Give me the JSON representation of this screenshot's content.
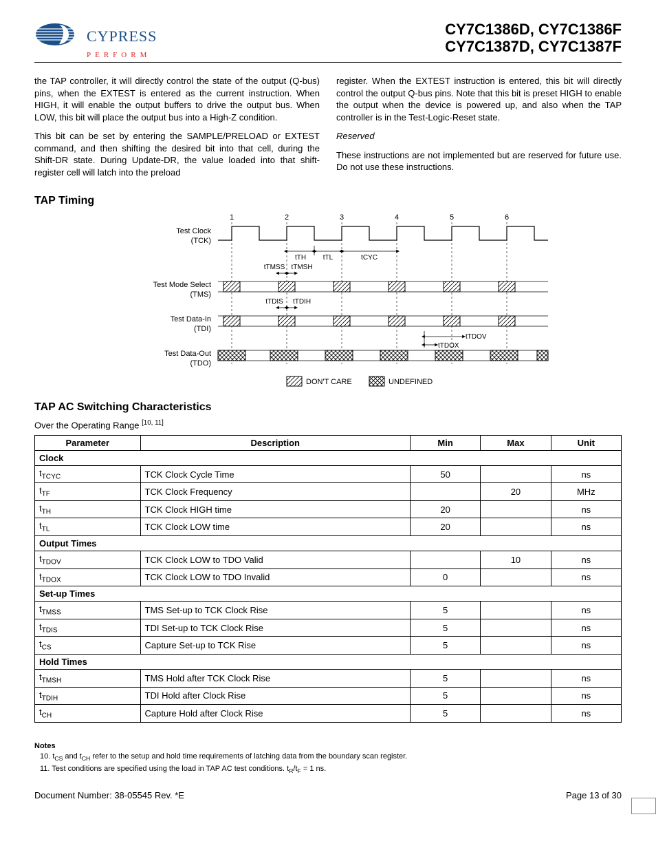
{
  "header": {
    "brand": "CYPRESS",
    "tagline": "PERFORM",
    "part_line1": "CY7C1386D, CY7C1386F",
    "part_line2": "CY7C1387D, CY7C1387F"
  },
  "body": {
    "left_p1": "the TAP controller, it will directly control the state of the output (Q-bus) pins, when the EXTEST is entered as the current instruction. When HIGH, it will enable the output buffers to drive the output bus. When LOW, this bit will place the output bus into a High-Z condition.",
    "left_p2": "This bit can be set by entering the SAMPLE/PRELOAD or EXTEST command, and then shifting the desired bit into that cell, during the Shift-DR state. During Update-DR, the value loaded into that shift-register cell will latch into the preload",
    "right_p1": "register. When the EXTEST instruction is entered, this bit will directly control the output Q-bus pins. Note that this bit is preset HIGH to enable the output when the device is powered up, and also when the TAP controller is in the Test-Logic-Reset state.",
    "reserved_head": "Reserved",
    "right_p2": "These instructions are not implemented but are reserved for future use. Do not use these instructions."
  },
  "tap_timing_heading": "TAP Timing",
  "timing": {
    "sig1": "Test Clock",
    "sig1b": "(TCK)",
    "sig2": "Test Mode Select",
    "sig2b": "(TMS)",
    "sig3": "Test Data-In",
    "sig3b": "(TDI)",
    "sig4": "Test Data-Out",
    "sig4b": "(TDO)",
    "legend_dontcare": "DON'T CARE",
    "legend_undefined": "UNDEFINED",
    "lbl_th": "tTH",
    "lbl_tl": "tTL",
    "lbl_cyc": "tCYC",
    "lbl_tmss": "tTMSS",
    "lbl_tmsh": "tTMSH",
    "lbl_tdis": "tTDIS",
    "lbl_tdih": "tTDIH",
    "lbl_tdov": "tTDOV",
    "lbl_tdox": "tTDOX"
  },
  "tap_ac_heading": "TAP AC Switching Characteristics",
  "range_text": "Over the Operating Range ",
  "range_refs": "[10, 11]",
  "table": {
    "headers": {
      "param": "Parameter",
      "desc": "Description",
      "min": "Min",
      "max": "Max",
      "unit": "Unit"
    },
    "sections": [
      {
        "title": "Clock",
        "rows": [
          {
            "p": "t",
            "ps": "TCYC",
            "d": "TCK Clock Cycle Time",
            "min": "50",
            "max": "",
            "unit": "ns"
          },
          {
            "p": "t",
            "ps": "TF",
            "d": "TCK Clock Frequency",
            "min": "",
            "max": "20",
            "unit": "MHz"
          },
          {
            "p": "t",
            "ps": "TH",
            "d": "TCK Clock HIGH time",
            "min": "20",
            "max": "",
            "unit": "ns"
          },
          {
            "p": "t",
            "ps": "TL",
            "d": "TCK Clock LOW time",
            "min": "20",
            "max": "",
            "unit": "ns"
          }
        ]
      },
      {
        "title": "Output Times",
        "rows": [
          {
            "p": "t",
            "ps": "TDOV",
            "d": "TCK Clock LOW to TDO Valid",
            "min": "",
            "max": "10",
            "unit": "ns"
          },
          {
            "p": "t",
            "ps": "TDOX",
            "d": "TCK Clock LOW to TDO Invalid",
            "min": "0",
            "max": "",
            "unit": "ns"
          }
        ]
      },
      {
        "title": "Set-up Times",
        "rows": [
          {
            "p": "t",
            "ps": "TMSS",
            "d": "TMS Set-up to TCK Clock Rise",
            "min": "5",
            "max": "",
            "unit": "ns"
          },
          {
            "p": "t",
            "ps": "TDIS",
            "d": "TDI Set-up to TCK Clock Rise",
            "min": "5",
            "max": "",
            "unit": "ns"
          },
          {
            "p": "t",
            "ps": "CS",
            "d": "Capture Set-up to TCK Rise",
            "min": "5",
            "max": "",
            "unit": "ns"
          }
        ]
      },
      {
        "title": "Hold Times",
        "rows": [
          {
            "p": "t",
            "ps": "TMSH",
            "d": "TMS Hold after TCK Clock Rise",
            "min": "5",
            "max": "",
            "unit": "ns"
          },
          {
            "p": "t",
            "ps": "TDIH",
            "d": "TDI Hold after Clock Rise",
            "min": "5",
            "max": "",
            "unit": "ns"
          },
          {
            "p": "t",
            "ps": "CH",
            "d": "Capture Hold after Clock Rise",
            "min": "5",
            "max": "",
            "unit": "ns"
          }
        ]
      }
    ]
  },
  "notes": {
    "heading": "Notes",
    "n10_pre": "10. t",
    "n10_s1": "CS",
    "n10_mid": " and t",
    "n10_s2": "CH",
    "n10_rest": " refer to the setup and hold time requirements of latching data from the boundary scan register.",
    "n11_pre": "11. Test conditions are specified using the load in TAP AC test conditions. t",
    "n11_s1": "R",
    "n11_mid": "/t",
    "n11_s2": "F",
    "n11_rest": " = 1 ns."
  },
  "footer": {
    "doc": "Document Number: 38-05545 Rev. *E",
    "page": "Page 13 of 30"
  }
}
